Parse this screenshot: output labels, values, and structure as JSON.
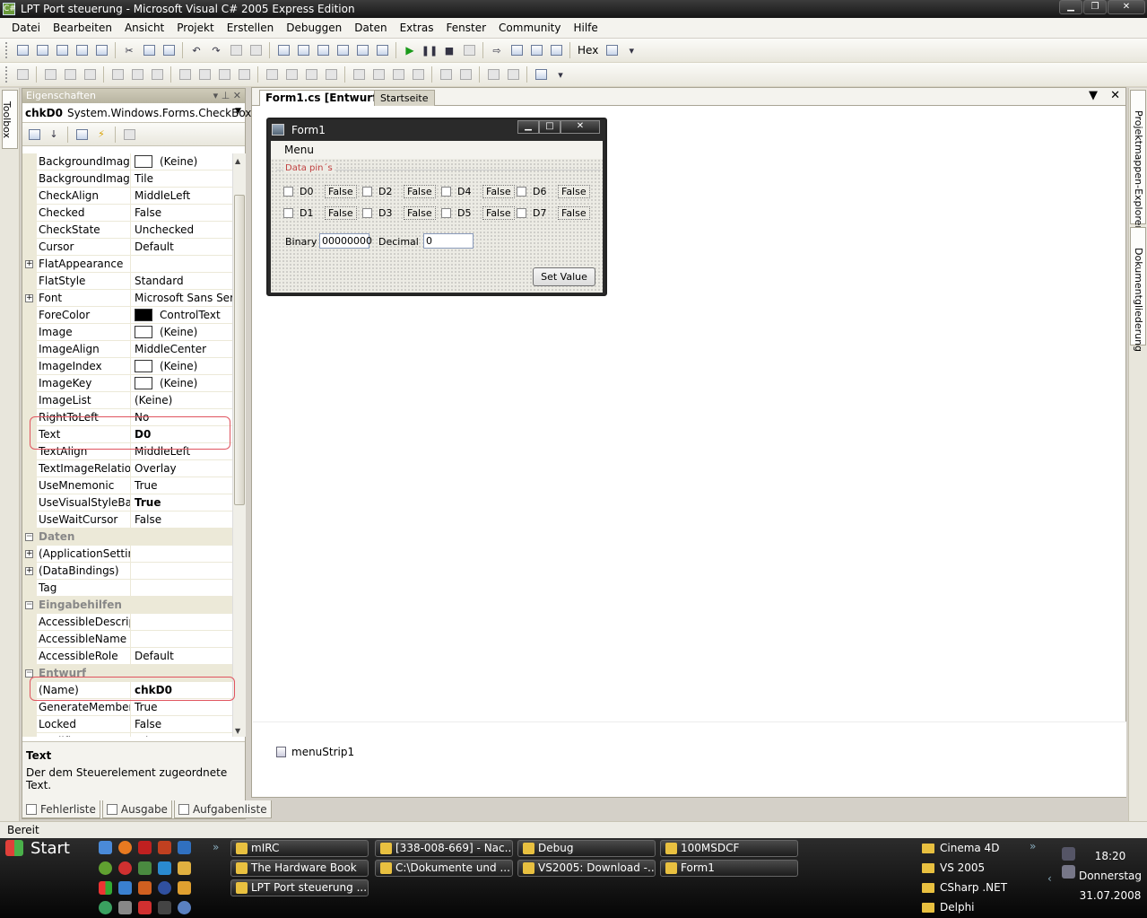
{
  "window": {
    "title": "LPT Port steuerung - Microsoft Visual C# 2005 Express Edition"
  },
  "menu": [
    "Datei",
    "Bearbeiten",
    "Ansicht",
    "Projekt",
    "Erstellen",
    "Debuggen",
    "Daten",
    "Extras",
    "Fenster",
    "Community",
    "Hilfe"
  ],
  "toolbar": {
    "hex_label": "Hex"
  },
  "toolbox": {
    "label": "Toolbox"
  },
  "properties": {
    "title": "Eigenschaften",
    "object_name": "chkD0",
    "object_type": "System.Windows.Forms.CheckBox",
    "rows": [
      {
        "name": "BackgroundImage",
        "value": "(Keine)",
        "swatch": "#ffffff"
      },
      {
        "name": "BackgroundImageL",
        "value": "Tile"
      },
      {
        "name": "CheckAlign",
        "value": "MiddleLeft"
      },
      {
        "name": "Checked",
        "value": "False"
      },
      {
        "name": "CheckState",
        "value": "Unchecked"
      },
      {
        "name": "Cursor",
        "value": "Default"
      },
      {
        "name": "FlatAppearance",
        "value": "",
        "expandable": true
      },
      {
        "name": "FlatStyle",
        "value": "Standard"
      },
      {
        "name": "Font",
        "value": "Microsoft Sans Serif;",
        "expandable": true
      },
      {
        "name": "ForeColor",
        "value": "ControlText",
        "swatch": "#000000"
      },
      {
        "name": "Image",
        "value": "(Keine)",
        "swatch": "#ffffff"
      },
      {
        "name": "ImageAlign",
        "value": "MiddleCenter"
      },
      {
        "name": "ImageIndex",
        "value": "(Keine)",
        "swatch": "#ffffff"
      },
      {
        "name": "ImageKey",
        "value": "(Keine)",
        "swatch": "#ffffff"
      },
      {
        "name": "ImageList",
        "value": "(Keine)"
      },
      {
        "name": "RightToLeft",
        "value": "No"
      },
      {
        "name": "Text",
        "value": "D0",
        "bold": true
      },
      {
        "name": "TextAlign",
        "value": "MiddleLeft"
      },
      {
        "name": "TextImageRelation",
        "value": "Overlay"
      },
      {
        "name": "UseMnemonic",
        "value": "True"
      },
      {
        "name": "UseVisualStyleBack",
        "value": "True",
        "bold": true
      },
      {
        "name": "UseWaitCursor",
        "value": "False"
      },
      {
        "name": "Daten",
        "category": true
      },
      {
        "name": "(ApplicationSetting",
        "value": "",
        "expandable": true
      },
      {
        "name": "(DataBindings)",
        "value": "",
        "expandable": true
      },
      {
        "name": "Tag",
        "value": ""
      },
      {
        "name": "Eingabehilfen",
        "category": true
      },
      {
        "name": "AccessibleDescripti",
        "value": ""
      },
      {
        "name": "AccessibleName",
        "value": ""
      },
      {
        "name": "AccessibleRole",
        "value": "Default"
      },
      {
        "name": "Entwurf",
        "category": true
      },
      {
        "name": "(Name)",
        "value": "chkD0",
        "bold": true
      },
      {
        "name": "GenerateMember",
        "value": "True"
      },
      {
        "name": "Locked",
        "value": "False"
      },
      {
        "name": "Modifiers",
        "value": "Private"
      }
    ],
    "description_title": "Text",
    "description_text": "Der dem Steuerelement zugeordnete Text."
  },
  "bottom_tabs": [
    "Fehlerliste",
    "Ausgabe",
    "Aufgabenliste"
  ],
  "doc_tabs": {
    "active": "Form1.cs [Entwurf]*",
    "inactive": "Startseite"
  },
  "form": {
    "title": "Form1",
    "menu": "Menu",
    "group_label": "Data pin´s",
    "checkboxes": [
      "D0",
      "D2",
      "D4",
      "D6",
      "D1",
      "D3",
      "D5",
      "D7"
    ],
    "false_label": "False",
    "binary_label": "Binary",
    "binary_value": "00000000",
    "decimal_label": "Decimal",
    "decimal_value": "0",
    "button": "Set Value"
  },
  "tray": {
    "component": "menuStrip1"
  },
  "right_tabs": [
    "Projektmappen-Explorer",
    "Dokumentgliederung"
  ],
  "status": {
    "text": "Bereit"
  },
  "taskbar": {
    "start": "Start",
    "tasks": [
      "mIRC",
      "[338-008-669] - Nac...",
      "Debug",
      "100MSDCF",
      "The Hardware Book",
      "C:\\Dokumente und ...",
      "VS2005: Download -...",
      "Form1",
      "LPT Port steuerung ..."
    ],
    "folders": [
      "Cinema 4D",
      "VS 2005",
      "CSharp .NET",
      "Delphi"
    ],
    "clock_time": "18:20",
    "clock_day": "Donnerstag",
    "clock_date": "31.07.2008"
  }
}
